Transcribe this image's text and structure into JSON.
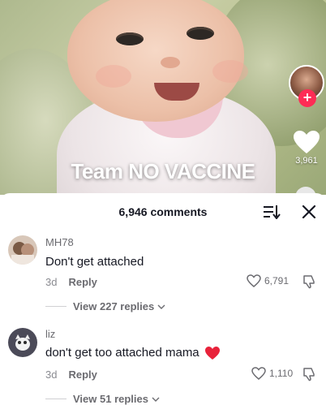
{
  "video": {
    "caption": "Team NO VACCINE",
    "like_count": "3,961"
  },
  "sheet": {
    "comment_count": "6,946 comments"
  },
  "comments": [
    {
      "username": "MH78",
      "text": "Don't get attached",
      "age": "3d",
      "reply_label": "Reply",
      "likes": "6,791",
      "view_replies": "View 227 replies"
    },
    {
      "username": "liz",
      "text": "don't get too attached mama",
      "age": "3d",
      "reply_label": "Reply",
      "likes": "1,110",
      "view_replies": "View 51 replies"
    }
  ],
  "colors": {
    "accent": "#fe2c55",
    "heart_emoji": "#e8223a"
  }
}
